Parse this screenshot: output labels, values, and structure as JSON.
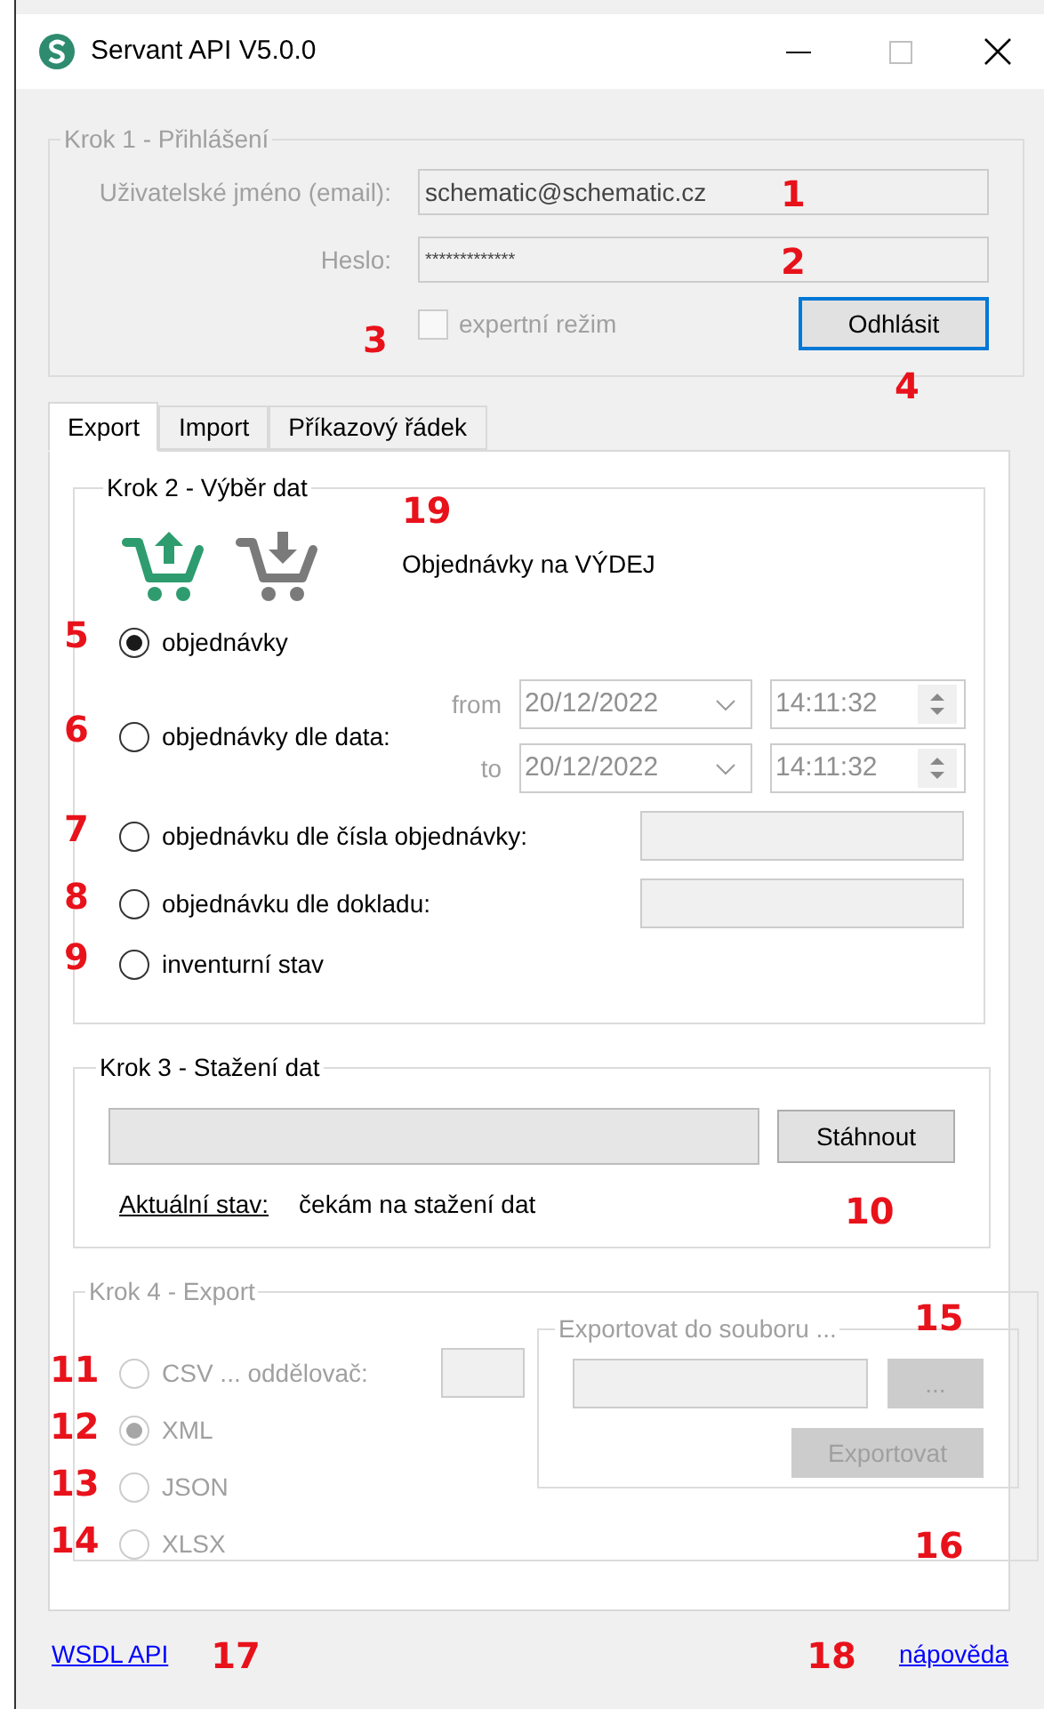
{
  "window": {
    "title": "Servant API V5.0.0"
  },
  "login": {
    "legend": "Krok 1 - Přihlášení",
    "disabled": true,
    "fields": [
      {
        "label": "Uživatelské jméno (email):",
        "value": "schematic@schematic.cz",
        "marker": "1"
      },
      {
        "label": "Heslo:",
        "value": "*************",
        "marker": "2"
      }
    ],
    "expert": {
      "label": "expertní režim",
      "checked": false,
      "marker": "3"
    },
    "logout_button": {
      "label": "Odhlásit",
      "marker": "4"
    }
  },
  "tabs": [
    {
      "label": "Export",
      "selected": true
    },
    {
      "label": "Import",
      "selected": false
    },
    {
      "label": "Příkazový řádek",
      "selected": false
    }
  ],
  "step2": {
    "legend": "Krok 2 - Výběr dat",
    "marker": "19",
    "direction_label": "Objednávky na VÝDEJ",
    "options": [
      {
        "kind": "plain",
        "label": "objednávky",
        "selected": true,
        "marker": "5"
      },
      {
        "kind": "date_range",
        "label": "objednávky dle data:",
        "selected": false,
        "marker": "6",
        "from_label": "from",
        "from_date": "20/12/2022",
        "from_time": "14:11:32",
        "to_label": "to",
        "to_date": "20/12/2022",
        "to_time": "14:11:32"
      },
      {
        "kind": "text",
        "label": "objednávku dle čísla objednávky:",
        "selected": false,
        "marker": "7"
      },
      {
        "kind": "text",
        "label": "objednávku dle dokladu:",
        "selected": false,
        "marker": "8"
      },
      {
        "kind": "plain",
        "label": "inventurní stav",
        "selected": false,
        "marker": "9"
      }
    ]
  },
  "step3": {
    "legend": "Krok 3 - Stažení dat",
    "progress": {
      "level": 0
    },
    "download_button": "Stáhnout",
    "status_label": "Aktuální stav:",
    "status_value": "čekám na stažení dat",
    "marker": "10"
  },
  "step4": {
    "legend": "Krok 4 - Export",
    "disabled": true,
    "formats": [
      {
        "kind": "csv",
        "label": "CSV ... oddělovač:",
        "selected": false,
        "marker": "11"
      },
      {
        "kind": "plain",
        "label": "XML",
        "selected": true,
        "marker": "12"
      },
      {
        "kind": "plain",
        "label": "JSON",
        "selected": false,
        "marker": "13"
      },
      {
        "kind": "plain",
        "label": "XLSX",
        "selected": false,
        "marker": "14"
      }
    ],
    "file_group": {
      "legend": "Exportovat do souboru ...",
      "browse_button": "...",
      "export_button": "Exportovat",
      "marker": "15",
      "marker_below": "16"
    }
  },
  "footer": {
    "links": [
      {
        "label": "WSDL API",
        "marker": "17"
      },
      {
        "label": "nápověda",
        "marker": "18"
      }
    ]
  }
}
